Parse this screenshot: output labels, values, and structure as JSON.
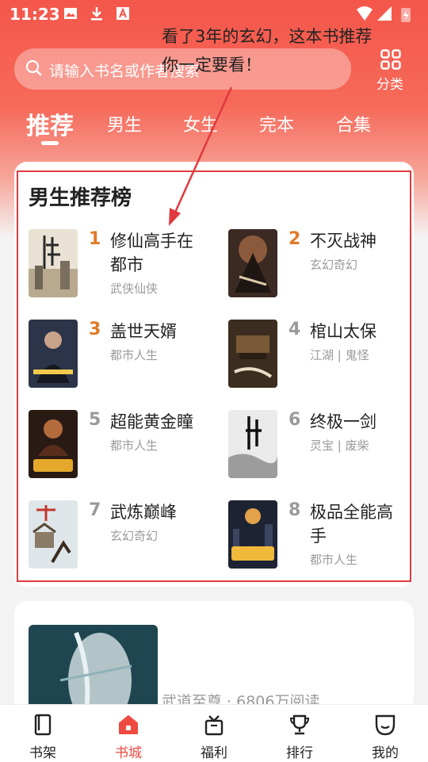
{
  "status_bar": {
    "time": "11:23",
    "icons": [
      "image-icon",
      "download-icon",
      "text-icon",
      "wifi-icon",
      "signal-icon",
      "battery-icon"
    ]
  },
  "search": {
    "placeholder": "请输入书名或作者搜索"
  },
  "category": {
    "label": "分类"
  },
  "tabs": [
    {
      "label": "推荐",
      "active": true
    },
    {
      "label": "男生",
      "active": false
    },
    {
      "label": "女生",
      "active": false
    },
    {
      "label": "完本",
      "active": false
    },
    {
      "label": "合集",
      "active": false
    }
  ],
  "ranking": {
    "title": "男生推荐榜",
    "books": [
      {
        "rank": "1",
        "title": "修仙高手在都市",
        "genre": "武侠仙侠"
      },
      {
        "rank": "2",
        "title": "不灭战神",
        "genre": "玄幻奇幻"
      },
      {
        "rank": "3",
        "title": "盖世天婿",
        "genre": "都市人生"
      },
      {
        "rank": "4",
        "title": "棺山太保",
        "genre": "江湖 | 鬼怪"
      },
      {
        "rank": "5",
        "title": "超能黄金瞳",
        "genre": "都市人生"
      },
      {
        "rank": "6",
        "title": "终极一剑",
        "genre": "灵宝 | 废柴"
      },
      {
        "rank": "7",
        "title": "武炼巅峰",
        "genre": "玄幻奇幻"
      },
      {
        "rank": "8",
        "title": "极品全能高手",
        "genre": "都市人生"
      }
    ]
  },
  "feature": {
    "text": "看了3年的玄幻，这本书推荐你一定要看！",
    "meta": "武道至尊 · 6806万阅读"
  },
  "bottom_nav": [
    {
      "label": "书架",
      "icon": "bookshelf-icon",
      "active": false
    },
    {
      "label": "书城",
      "icon": "bookstore-icon",
      "active": true
    },
    {
      "label": "福利",
      "icon": "gift-icon",
      "active": false
    },
    {
      "label": "排行",
      "icon": "trophy-icon",
      "active": false
    },
    {
      "label": "我的",
      "icon": "profile-icon",
      "active": false
    }
  ],
  "colors": {
    "brand": "#ef4a41",
    "rank_highlight": "#e07b29",
    "annotation": "#e0393e"
  }
}
